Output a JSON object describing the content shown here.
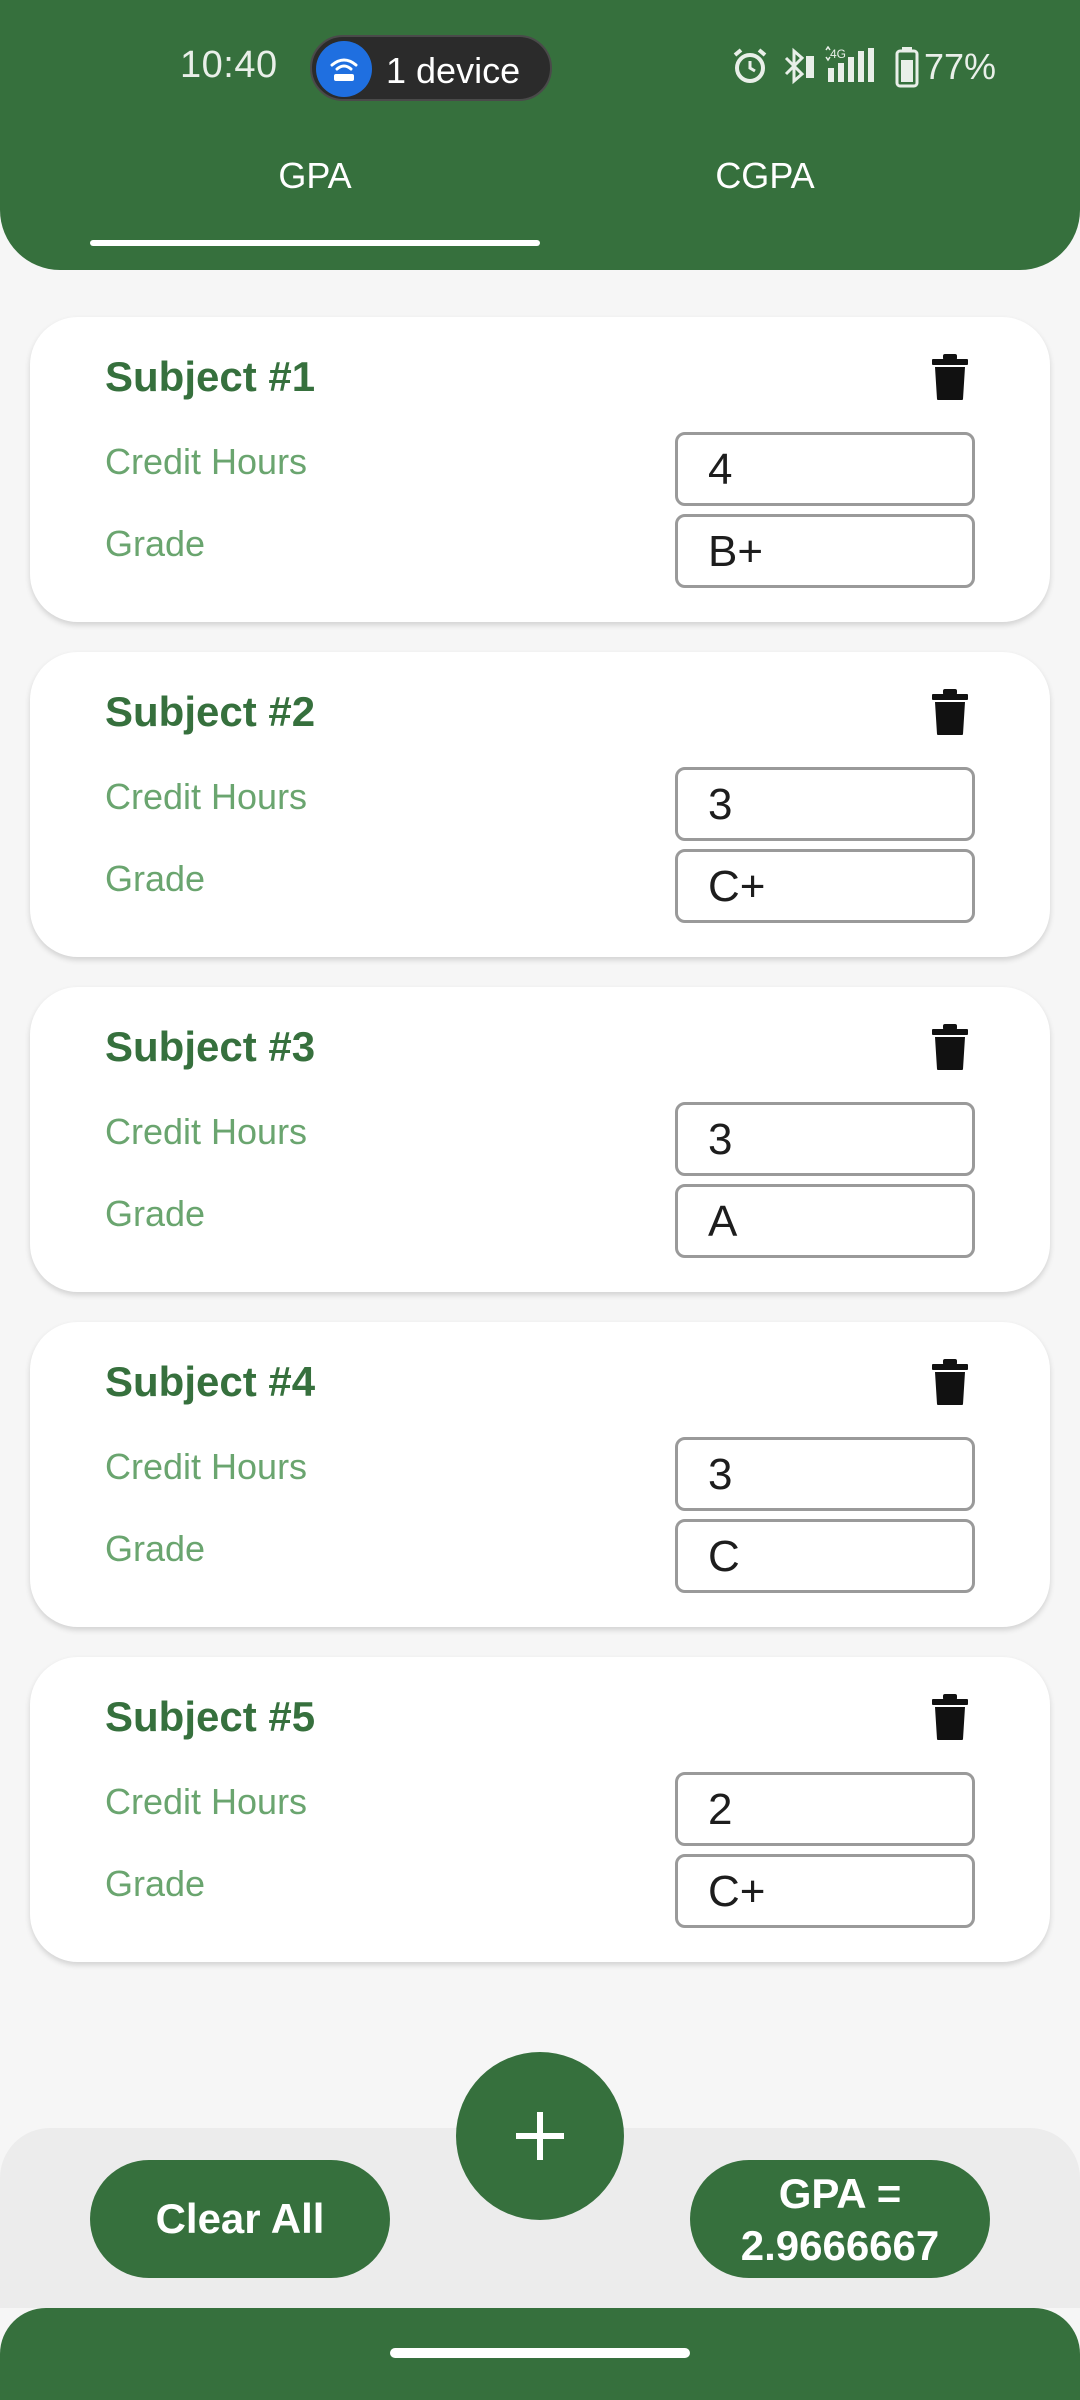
{
  "status_bar": {
    "time": "10:40",
    "hotspot_label": "1 device",
    "battery": "77%",
    "icons": [
      "alarm-icon",
      "bluetooth-icon",
      "4g-signal-icon",
      "battery-icon"
    ]
  },
  "tabs": [
    {
      "label": "GPA",
      "selected": true
    },
    {
      "label": "CGPA",
      "selected": false
    }
  ],
  "labels": {
    "credit_hours": "Credit Hours",
    "grade": "Grade"
  },
  "subjects": [
    {
      "title": "Subject #1",
      "credit_hours": "4",
      "grade": "B+"
    },
    {
      "title": "Subject #2",
      "credit_hours": "3",
      "grade": "C+"
    },
    {
      "title": "Subject #3",
      "credit_hours": "3",
      "grade": "A"
    },
    {
      "title": "Subject #4",
      "credit_hours": "3",
      "grade": "C"
    },
    {
      "title": "Subject #5",
      "credit_hours": "2",
      "grade": "C+"
    }
  ],
  "footer": {
    "clear_label": "Clear All",
    "add_icon": "plus-icon",
    "gpa_label": "GPA =",
    "gpa_value": "2.9666667"
  },
  "colors": {
    "primary": "#36703d",
    "label": "#6aa56f",
    "hotspot": "#1f6fe0"
  }
}
